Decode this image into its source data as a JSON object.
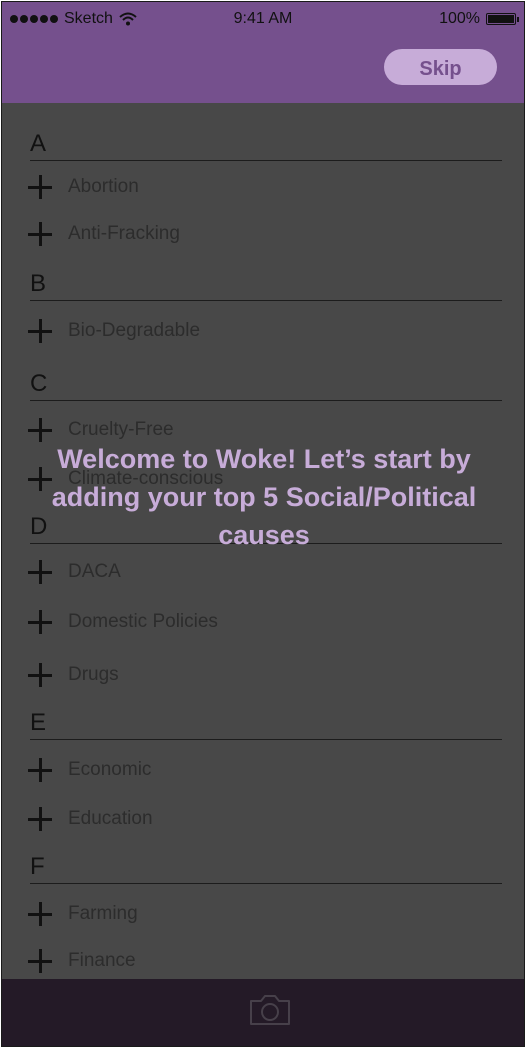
{
  "status_bar": {
    "carrier": "Sketch",
    "time": "9:41 AM",
    "battery": "100%"
  },
  "nav": {
    "skip_label": "Skip"
  },
  "welcome_text": "Welcome to Woke! Let’s start by adding your top 5 Social/Political causes",
  "sections": [
    {
      "letter": "A",
      "items": [
        "Abortion",
        "Anti-Fracking"
      ]
    },
    {
      "letter": "B",
      "items": [
        "Bio-Degradable"
      ]
    },
    {
      "letter": "C",
      "items": [
        "Cruelty-Free",
        "Climate-conscious"
      ]
    },
    {
      "letter": "D",
      "items": [
        "DACA",
        "Domestic Policies",
        "Drugs"
      ]
    },
    {
      "letter": "E",
      "items": [
        "Economic",
        "Education"
      ]
    },
    {
      "letter": "F",
      "items": [
        "Farming",
        "Finance"
      ]
    }
  ],
  "bottom_bar": {
    "icon": "camera-icon"
  },
  "colors": {
    "brand_purple": "#75508d",
    "light_purple": "#c7acd8",
    "overlay_gray": "#484848",
    "bottom_bar": "#241a27"
  }
}
